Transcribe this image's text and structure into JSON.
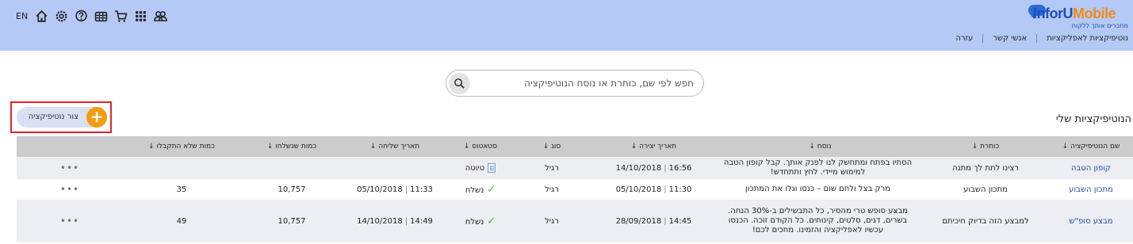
{
  "brand": {
    "name_part1": "InforU",
    "name_part2": "Mobile",
    "tagline": "מחברים אותך ללקוח"
  },
  "toolbar": {
    "language": "EN",
    "icons": [
      "home-icon",
      "settings-icon",
      "help-icon",
      "billing-icon",
      "cart-icon",
      "apps-grid-icon",
      "users-icon"
    ]
  },
  "nav": {
    "items": [
      "נוטיפיקציות לאפליקציות",
      "אנשי קשר",
      "עזרה"
    ]
  },
  "search": {
    "placeholder": "חפש לפי שם, כותרת או נוסח הנוטיפיקציה"
  },
  "create_button": {
    "label": "צור נוטיפיקציה",
    "plus": "+"
  },
  "section_title": "הנוטיפיקציות שלי",
  "table": {
    "headers": [
      "שם הנוטיפיקציה ↓",
      "כותרת ↓",
      "נוסח ↓",
      "תאריך יצירה ↓",
      "סוג ↓",
      "סטאטוס ↓",
      "תאריך שליחה ↓",
      "כמות שנשלחו ↓",
      "כמות שלא התקבלו ↓",
      ""
    ],
    "rows": [
      {
        "name": "קופון הטבה",
        "title": "רצינו לתת לך מתנה",
        "body": "הסתיו בפתח ומתחשק לנו לפנק אותך. קבל קופון הטבה למימוש מיידי. לחץ ותתחדש!",
        "created_date": "14/10/2018",
        "created_time": "16:56",
        "type": "רגיל",
        "status": "טיוטה",
        "sent_date": "",
        "sent_time": "",
        "sent_count": "",
        "not_received": "",
        "menu": "•••"
      },
      {
        "name": "מתכון השבוע",
        "title": "מתכון השבוע",
        "body": "מרק בצל ולחם שום – כנסו וגלו את המתכון",
        "created_date": "05/10/2018",
        "created_time": "11:30",
        "type": "רגיל",
        "status": "נשלח",
        "sent_date": "05/10/2018",
        "sent_time": "11:33",
        "sent_count": "10,757",
        "not_received": "35",
        "menu": "•••"
      },
      {
        "name": "מבצע סופ\"ש",
        "title": "למבצע הזה בדיוק חיכיתם",
        "body": "מבצע סופש טרי מהסיר, כל התבשילים ב-30% הנחה. בשרים, דגים, סלטים, קינוחים. כל הקודם זוכה. הכנסו עכשיו לאפליקציה והזמינו. מחכים לכם!",
        "created_date": "28/09/2018",
        "created_time": "14:45",
        "type": "רגיל",
        "status": "נשלח",
        "sent_date": "14/10/2018",
        "sent_time": "14:49",
        "sent_count": "10,757",
        "not_received": "49",
        "menu": "•••"
      }
    ]
  },
  "colors": {
    "header_bg": "#b4c9f5",
    "accent_orange": "#f39c12",
    "highlight_red": "#e2252c",
    "check_green": "#52b043"
  }
}
